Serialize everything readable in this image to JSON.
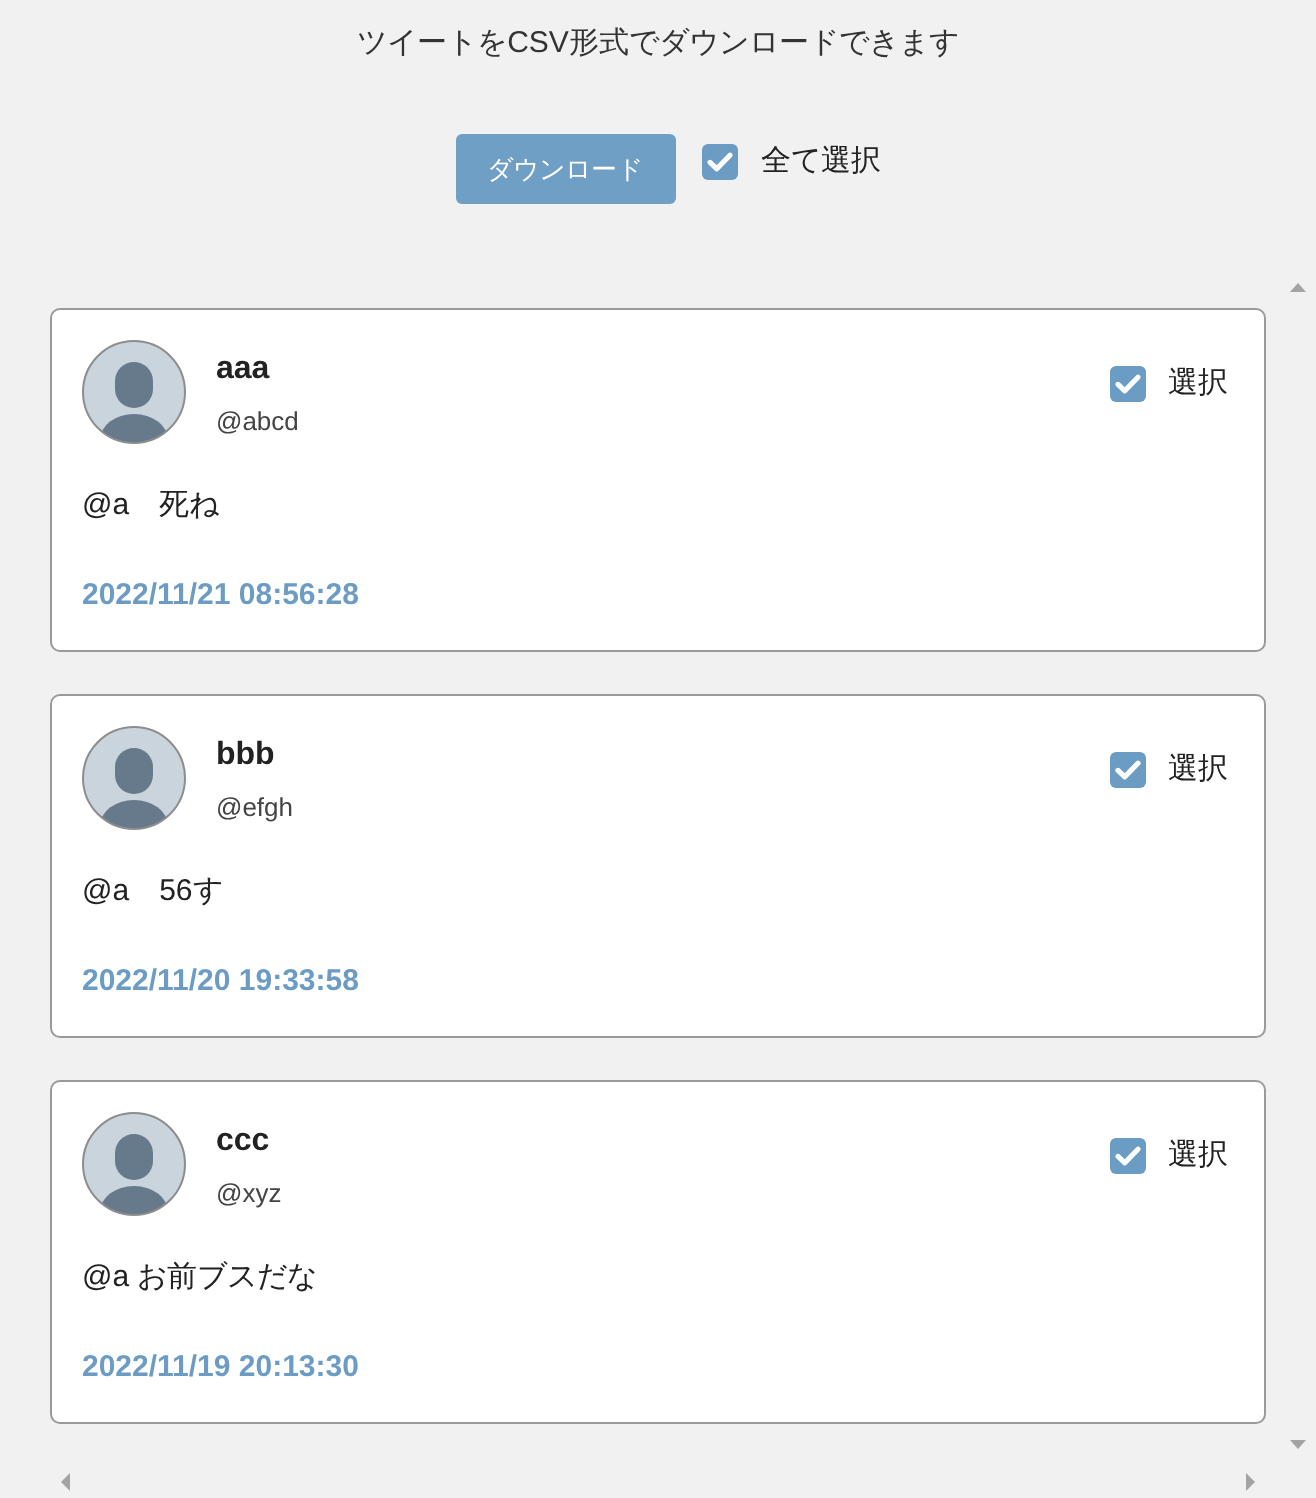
{
  "header": {
    "title": "ツイートをCSV形式でダウンロードできます"
  },
  "toolbar": {
    "download_button": "ダウンロード",
    "select_all": {
      "label": "全て選択",
      "checked": true
    }
  },
  "tweets": [
    {
      "name": "aaa",
      "handle": "@abcd",
      "text": "@a　死ね",
      "date": "2022/11/21 08:56:28",
      "select_label": "選択",
      "checked": true
    },
    {
      "name": "bbb",
      "handle": "@efgh",
      "text": "@a　56す",
      "date": "2022/11/20 19:33:58",
      "select_label": "選択",
      "checked": true
    },
    {
      "name": "ccc",
      "handle": "@xyz",
      "text": "@a お前ブスだな",
      "date": "2022/11/19 20:13:30",
      "select_label": "選択",
      "checked": true
    }
  ]
}
